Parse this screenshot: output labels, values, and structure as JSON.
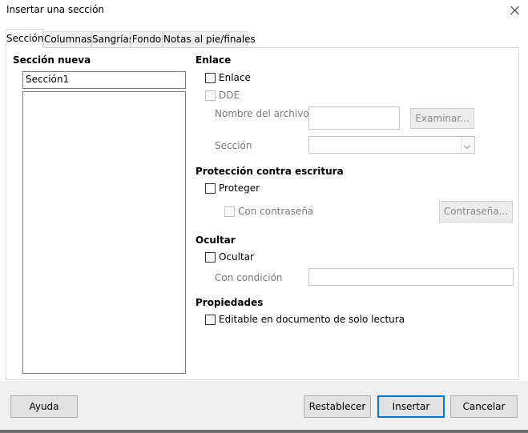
{
  "window": {
    "title": "Insertar una sección",
    "close_icon": "close-icon"
  },
  "tabs": [
    {
      "label": "Sección",
      "active": true
    },
    {
      "label": "Columnas",
      "active": false
    },
    {
      "label": "Sangrías",
      "active": false
    },
    {
      "label": "Fondo",
      "active": false
    },
    {
      "label": "Notas al pie/finales",
      "active": false
    }
  ],
  "new_section": {
    "heading": "Sección nueva",
    "name_value": "Sección1",
    "list_items": []
  },
  "link": {
    "heading": "Enlace",
    "link_checkbox": {
      "label": "Enlace",
      "checked": false
    },
    "dde_checkbox": {
      "label": "DDE",
      "checked": false,
      "enabled": false
    },
    "file_name_label": "Nombre del archivo",
    "file_name_value": "",
    "browse_button": "Examinar...",
    "section_label": "Sección",
    "section_value": ""
  },
  "write_protection": {
    "heading": "Protección contra escritura",
    "protect_checkbox": {
      "label": "Proteger",
      "checked": false
    },
    "with_password_checkbox": {
      "label": "Con contraseña",
      "checked": false,
      "enabled": false
    },
    "password_button": "Contraseña..."
  },
  "hide": {
    "heading": "Ocultar",
    "hide_checkbox": {
      "label": "Ocultar",
      "checked": false
    },
    "condition_label": "Con condición",
    "condition_value": ""
  },
  "properties": {
    "heading": "Propiedades",
    "editable_readonly_checkbox": {
      "label": "Editable en documento de solo lectura",
      "checked": false
    }
  },
  "footer": {
    "help_button": "Ayuda",
    "reset_button": "Restablecer",
    "insert_button": "Insertar",
    "cancel_button": "Cancelar"
  }
}
